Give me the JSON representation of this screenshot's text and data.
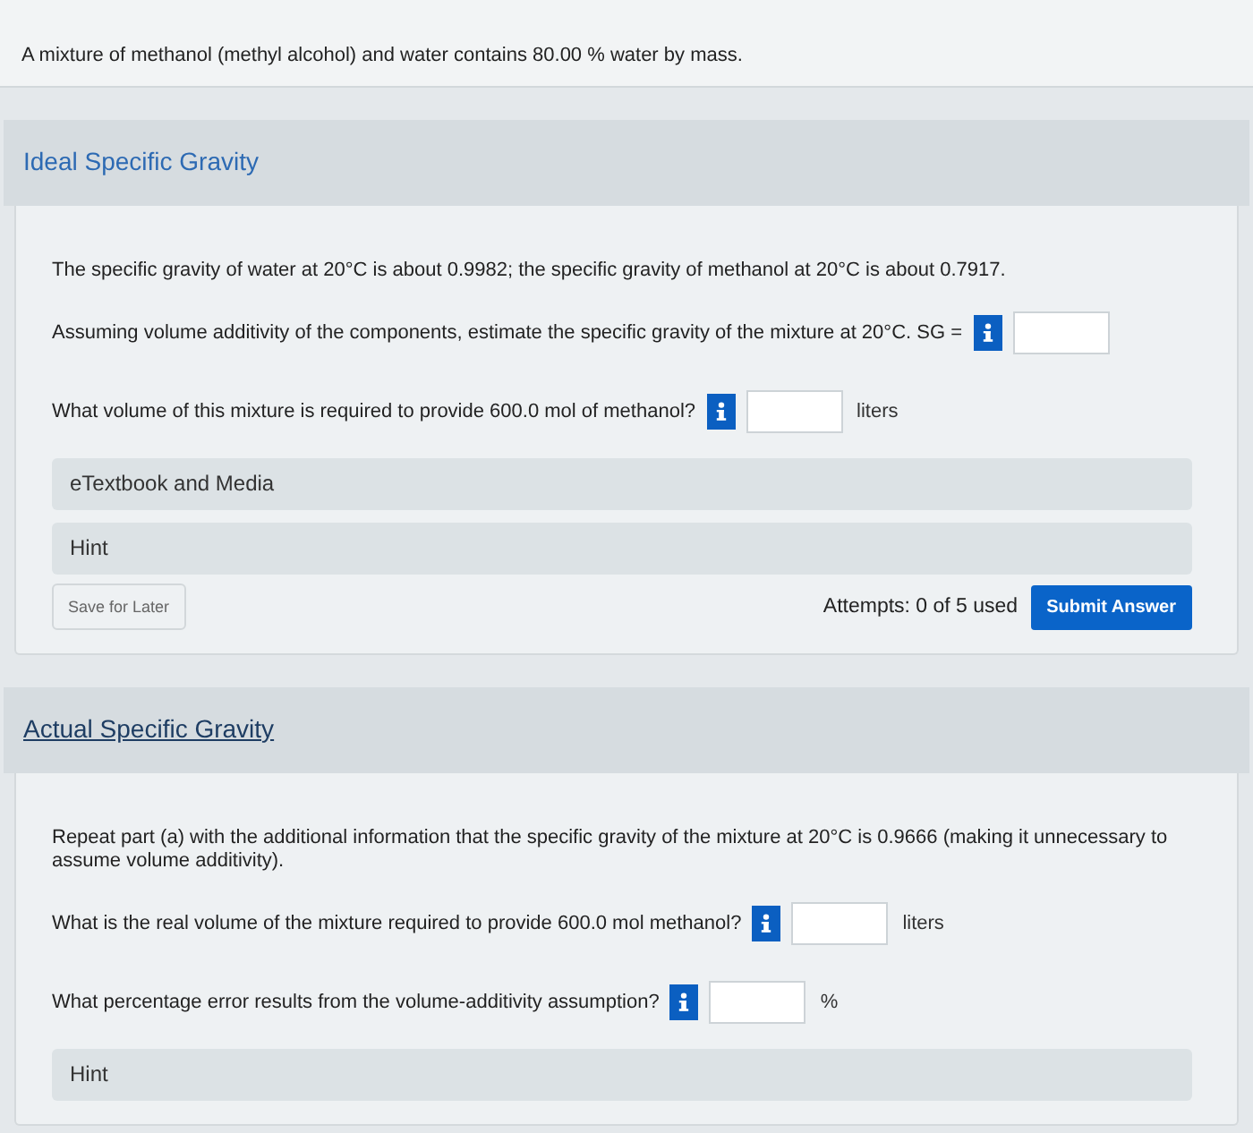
{
  "problem": {
    "text": "A mixture of methanol (methyl alcohol) and water contains 80.00 % water by mass."
  },
  "parts": [
    {
      "title": "Ideal Specific Gravity",
      "hovered": false,
      "intro": [
        "The specific gravity of water at 20°C is about 0.9982; the specific gravity of methanol at 20°C is about 0.7917."
      ],
      "questions": [
        {
          "text": "Assuming volume additivity of the components, estimate the specific gravity of the mixture at 20°C. SG ="
        },
        {
          "text": "What volume of this mixture is required to provide 600.0 mol of methanol?",
          "unit": "liters"
        }
      ],
      "panels": [
        "eTextbook and Media",
        "Hint"
      ],
      "footer": {
        "save_button": "Save for Later",
        "attempts": "Attempts: 0 of 5 used",
        "submit_button": "Submit Answer"
      }
    },
    {
      "title": "Actual Specific Gravity",
      "hovered": true,
      "intro": [
        "Repeat part (a) with the additional information that the specific gravity of the mixture at 20°C is 0.9666 (making it unnecessary to assume volume additivity)."
      ],
      "questions": [
        {
          "text": "What is the real volume of the mixture required to provide 600.0 mol methanol?",
          "unit": "liters"
        },
        {
          "text": "What percentage error results from the volume-additivity assumption?",
          "unit": "%"
        }
      ],
      "panels": [
        "Hint"
      ]
    }
  ]
}
